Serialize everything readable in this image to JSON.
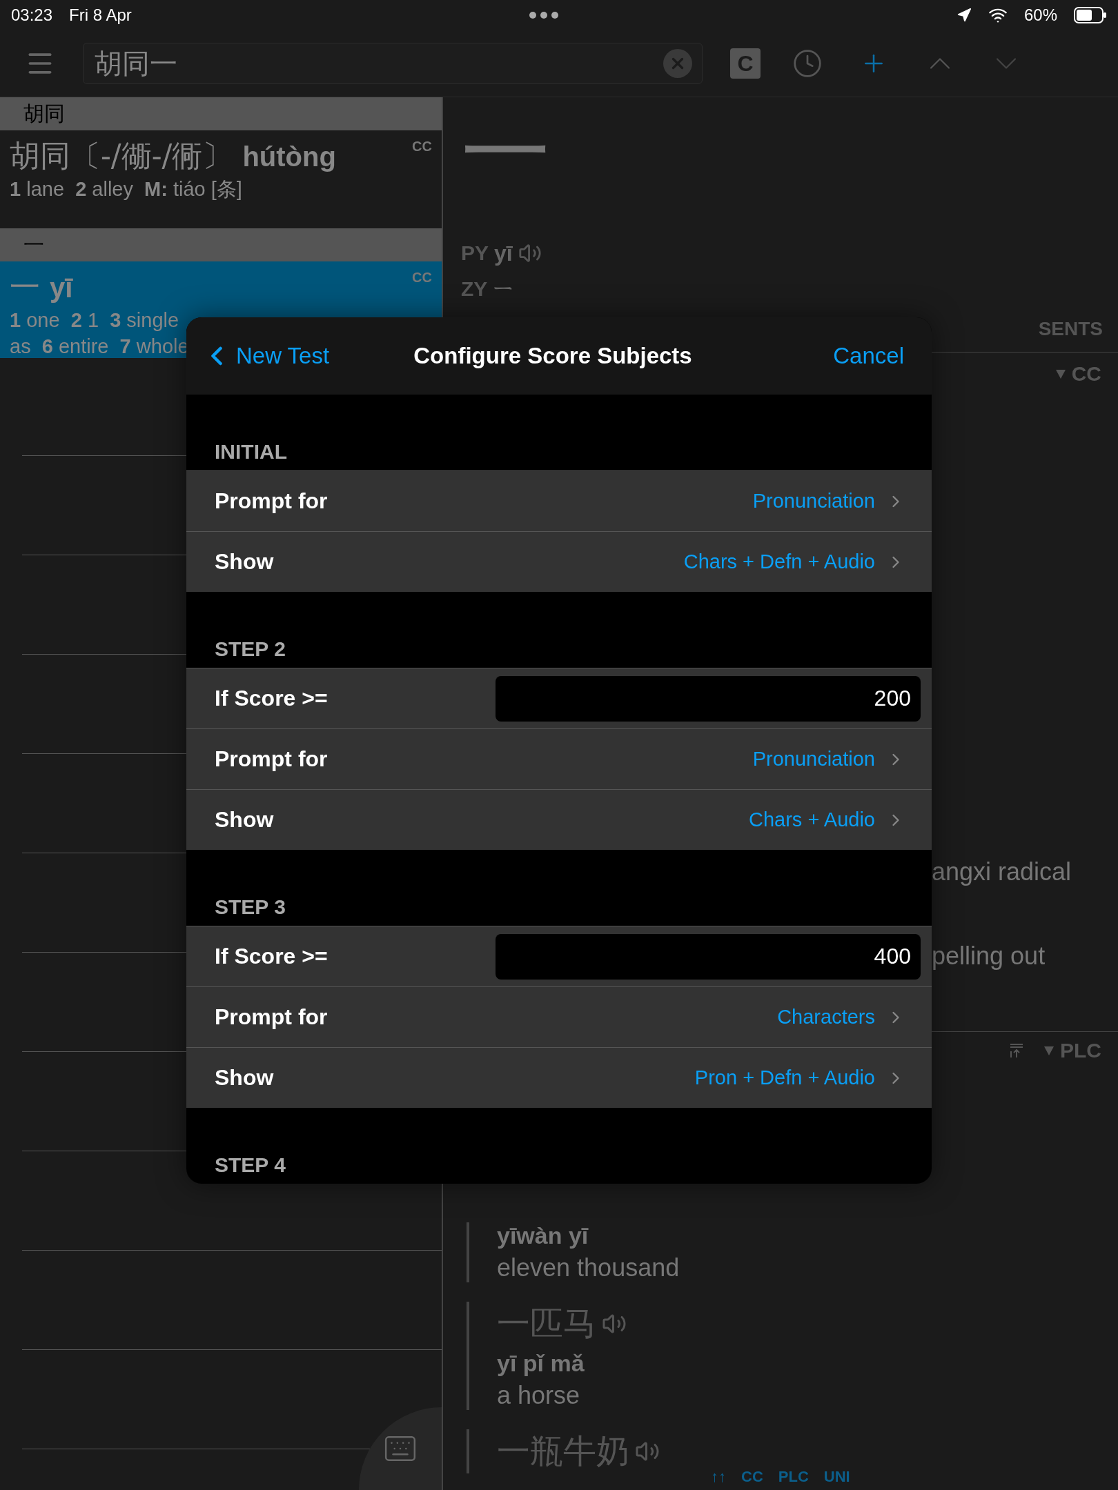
{
  "status_bar": {
    "time": "03:23",
    "date": "Fri 8 Apr",
    "battery": "60%"
  },
  "toolbar": {
    "search_value": "胡同一",
    "c_button": "C"
  },
  "results": [
    {
      "header": "胡同",
      "headword": "胡同〔-/衚-/衕〕",
      "pinyin": "hútòng",
      "source": "CC",
      "definition": [
        "**1** lane  **2** alley  **M:** tiáo [条]"
      ],
      "selected": false
    },
    {
      "header": "一",
      "headword": "一",
      "pinyin": "yī",
      "source": "CC",
      "definition": [
        "**1** one  **2** 1  **3** single",
        "as  **6** entire  **7** whole"
      ],
      "selected": true
    }
  ],
  "detail": {
    "character": "一",
    "py_label": "PY",
    "py": "yī",
    "zy_label": "ZY",
    "zy": "ㄧ",
    "tabs": [
      {
        "label": "SENTS",
        "selected": false
      }
    ],
    "cc_source": "CC",
    "cc_lines": [
      "angxi radical",
      "pelling out"
    ],
    "plc_source": "PLC",
    "sentences": [
      {
        "pinyin": "yīwàn yī",
        "english": "eleven thousand"
      },
      {
        "chars": "一匹马",
        "pinyin": "yī pǐ mǎ",
        "english": "a horse"
      },
      {
        "chars": "一瓶牛奶"
      }
    ]
  },
  "footer_links": [
    "↑↑",
    "CC",
    "PLC",
    "UNI"
  ],
  "modal": {
    "back": "New Test",
    "title": "Configure Score Subjects",
    "cancel": "Cancel",
    "sections": [
      {
        "title": "INITIAL",
        "rows": [
          {
            "kind": "link",
            "label": "Prompt for",
            "value": "Pronunciation"
          },
          {
            "kind": "link",
            "label": "Show",
            "value": "Chars + Defn + Audio"
          }
        ]
      },
      {
        "title": "STEP 2",
        "rows": [
          {
            "kind": "input",
            "label": "If Score >=",
            "value": "200"
          },
          {
            "kind": "link",
            "label": "Prompt for",
            "value": "Pronunciation"
          },
          {
            "kind": "link",
            "label": "Show",
            "value": "Chars + Audio"
          }
        ]
      },
      {
        "title": "STEP 3",
        "rows": [
          {
            "kind": "input",
            "label": "If Score >=",
            "value": "400"
          },
          {
            "kind": "link",
            "label": "Prompt for",
            "value": "Characters"
          },
          {
            "kind": "link",
            "label": "Show",
            "value": "Pron + Defn + Audio"
          }
        ]
      },
      {
        "title": "STEP 4"
      }
    ]
  }
}
